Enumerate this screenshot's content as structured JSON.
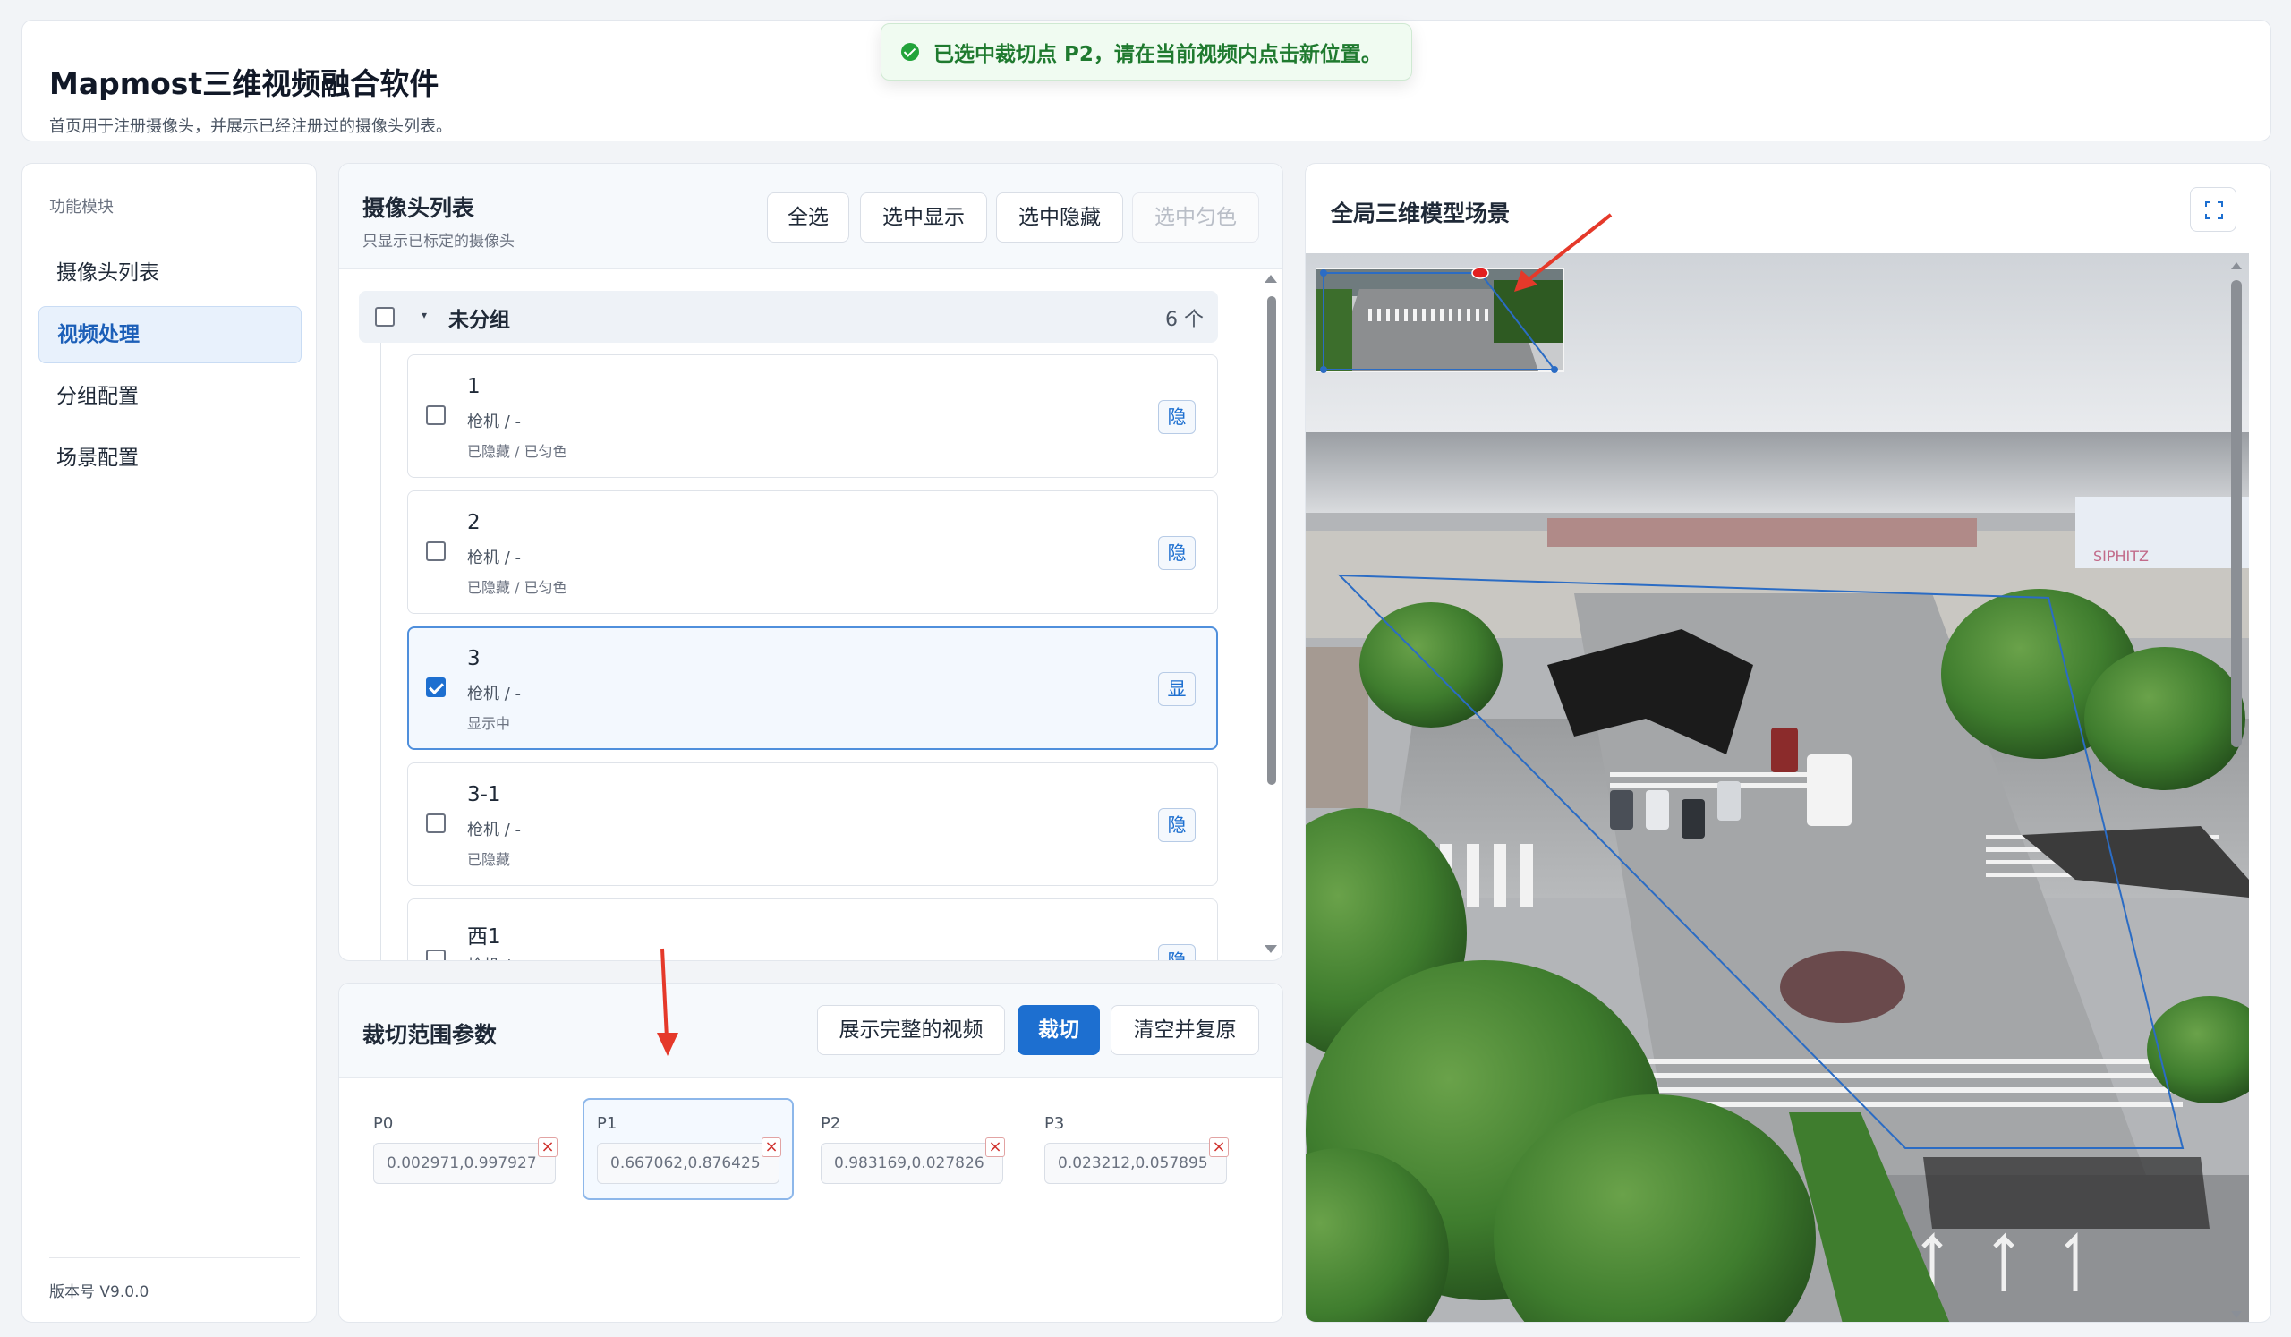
{
  "header": {
    "title": "Mapmost三维视频融合软件",
    "subtitle": "首页用于注册摄像头，并展示已经注册过的摄像头列表。"
  },
  "toast": {
    "icon": "check-circle-icon",
    "message": "已选中裁切点 P2，请在当前视频内点击新位置。"
  },
  "sidebar": {
    "section_label": "功能模块",
    "items": [
      {
        "label": "摄像头列表",
        "active": false
      },
      {
        "label": "视频处理",
        "active": true
      },
      {
        "label": "分组配置",
        "active": false
      },
      {
        "label": "场景配置",
        "active": false
      }
    ],
    "version": "版本号 V9.0.0"
  },
  "camera_panel": {
    "title": "摄像头列表",
    "subtitle": "只显示已标定的摄像头",
    "buttons": {
      "select_all": "全选",
      "show_selected": "选中显示",
      "hide_selected": "选中隐藏",
      "color_selected": "选中匀色"
    },
    "group": {
      "name": "未分组",
      "count": "6 个"
    },
    "cameras": [
      {
        "name": "1",
        "type": "枪机 / -",
        "status": "已隐藏 / 已匀色",
        "toggle": "隐",
        "checked": false
      },
      {
        "name": "2",
        "type": "枪机 / -",
        "status": "已隐藏 / 已匀色",
        "toggle": "隐",
        "checked": false
      },
      {
        "name": "3",
        "type": "枪机 / -",
        "status": "显示中",
        "toggle": "显",
        "checked": true
      },
      {
        "name": "3-1",
        "type": "枪机 / -",
        "status": "已隐藏",
        "toggle": "隐",
        "checked": false
      },
      {
        "name": "西1",
        "type": "枪机 / -",
        "status": "",
        "toggle": "隐",
        "checked": false
      }
    ]
  },
  "crop_panel": {
    "title": "裁切范围参数",
    "buttons": {
      "show_full": "展示完整的视频",
      "crop": "裁切",
      "clear_restore": "清空并复原"
    },
    "points": [
      {
        "label": "P0",
        "value": "0.002971,0.997927"
      },
      {
        "label": "P1",
        "value": "0.667062,0.876425"
      },
      {
        "label": "P2",
        "value": "0.983169,0.027826"
      },
      {
        "label": "P3",
        "value": "0.023212,0.057895"
      }
    ]
  },
  "scene_panel": {
    "title": "全局三维模型场景",
    "sign_text": "SIPHITZ"
  },
  "colors": {
    "primary": "#1d6fd0",
    "success": "#22a33a",
    "annotation": "#e5392a"
  }
}
